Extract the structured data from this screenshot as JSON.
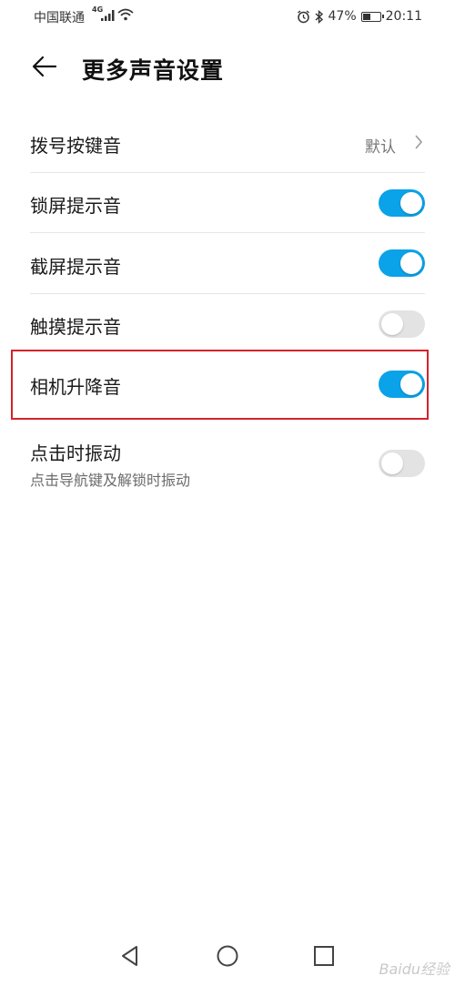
{
  "status_bar": {
    "carrier": "中国联通",
    "network": "4G",
    "battery": "47%",
    "battery_level": 0.47,
    "time": "20:11",
    "icons": [
      "signal-icon",
      "wifi-icon",
      "alarm-icon",
      "bluetooth-icon",
      "battery-icon"
    ]
  },
  "header": {
    "back_icon": "back-arrow-icon",
    "title": "更多声音设置"
  },
  "settings": [
    {
      "label": "拨号按键音",
      "value": "默认",
      "control": "chevron"
    },
    {
      "label": "锁屏提示音",
      "toggle": true
    },
    {
      "label": "截屏提示音",
      "toggle": true
    },
    {
      "label": "触摸提示音",
      "toggle": false
    },
    {
      "label": "相机升降音",
      "toggle": true,
      "highlighted": true
    },
    {
      "label": "点击时振动",
      "sublabel": "点击导航键及解锁时振动",
      "toggle": false
    }
  ],
  "accent_color": "#0aa2e8",
  "highlight_color": "#d3232b",
  "nav_bar": {
    "icons": [
      "nav-back-icon",
      "nav-home-icon",
      "nav-recents-icon"
    ]
  },
  "watermark": "Baidu经验"
}
